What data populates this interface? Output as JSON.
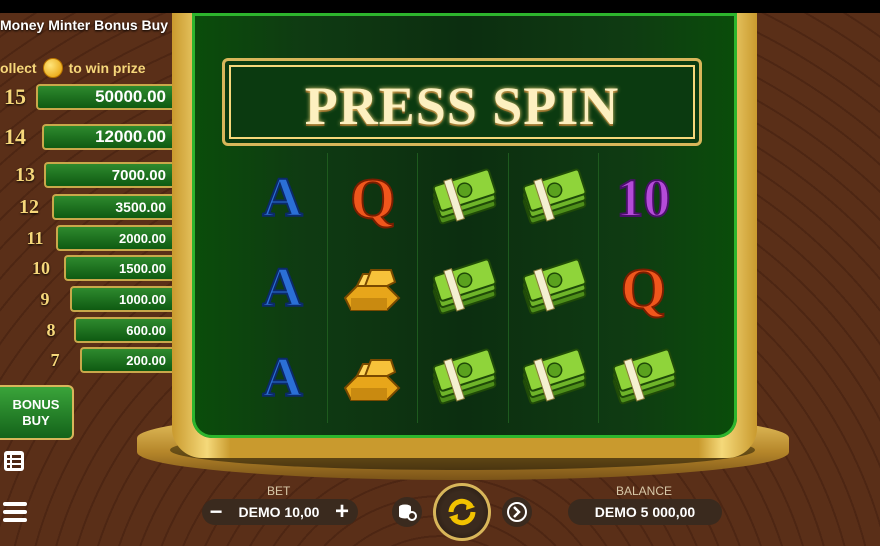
{
  "game": {
    "title": "Money Minter Bonus Buy",
    "collect_prefix": "ollect",
    "collect_suffix": "to win prize",
    "marquee": "PRESS SPIN"
  },
  "ladder": [
    {
      "level": "15",
      "prize": "50000.00"
    },
    {
      "level": "14",
      "prize": "12000.00"
    },
    {
      "level": "13",
      "prize": "7000.00"
    },
    {
      "level": "12",
      "prize": "3500.00"
    },
    {
      "level": "11",
      "prize": "2000.00"
    },
    {
      "level": "10",
      "prize": "1500.00"
    },
    {
      "level": "9",
      "prize": "1000.00"
    },
    {
      "level": "8",
      "prize": "600.00"
    },
    {
      "level": "7",
      "prize": "200.00"
    }
  ],
  "bonus_buy": {
    "line1": "BONUS",
    "line2": "BUY"
  },
  "reels": [
    [
      "A",
      "A",
      "A"
    ],
    [
      "Q",
      "gold-bars",
      "gold-bars"
    ],
    [
      "cash-stack",
      "cash-stack",
      "cash-stack"
    ],
    [
      "cash-stack",
      "cash-stack",
      "cash-stack"
    ],
    [
      "10",
      "Q",
      "cash-stack"
    ]
  ],
  "controls": {
    "bet_label": "BET",
    "bet_value": "DEMO 10,00",
    "balance_label": "BALANCE",
    "balance_value": "DEMO 5 000,00",
    "minus": "−",
    "plus": "+"
  },
  "colors": {
    "accent_gold": "#d8b65a",
    "panel_green": "#0f3b12",
    "spin_gold": "#f2c200"
  }
}
